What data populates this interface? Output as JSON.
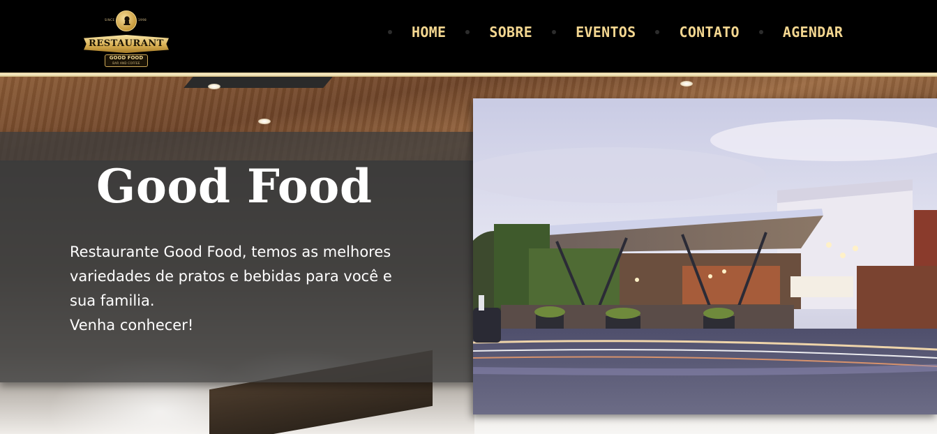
{
  "logo": {
    "name": "RESTAURANT",
    "tagline": "GOOD FOOD",
    "subtagline": "BAR AND COFFEE",
    "since_left": "SINCE",
    "since_right": "1998"
  },
  "nav": {
    "items": [
      {
        "label": "HOME"
      },
      {
        "label": "SOBRE"
      },
      {
        "label": "EVENTOS"
      },
      {
        "label": "CONTATO"
      },
      {
        "label": "AGENDAR"
      }
    ]
  },
  "hero": {
    "title": "Good Food",
    "text_lines": [
      "Restaurante Good Food, temos as melhores",
      "variedades de pratos e bebidas para você e",
      "sua familia.",
      "Venha conhecer!"
    ]
  },
  "colors": {
    "header_bg": "#000000",
    "nav_text": "#f3d690",
    "accent_line": "#f1e3b5",
    "overlay": "rgba(62,62,62,0.78)"
  }
}
